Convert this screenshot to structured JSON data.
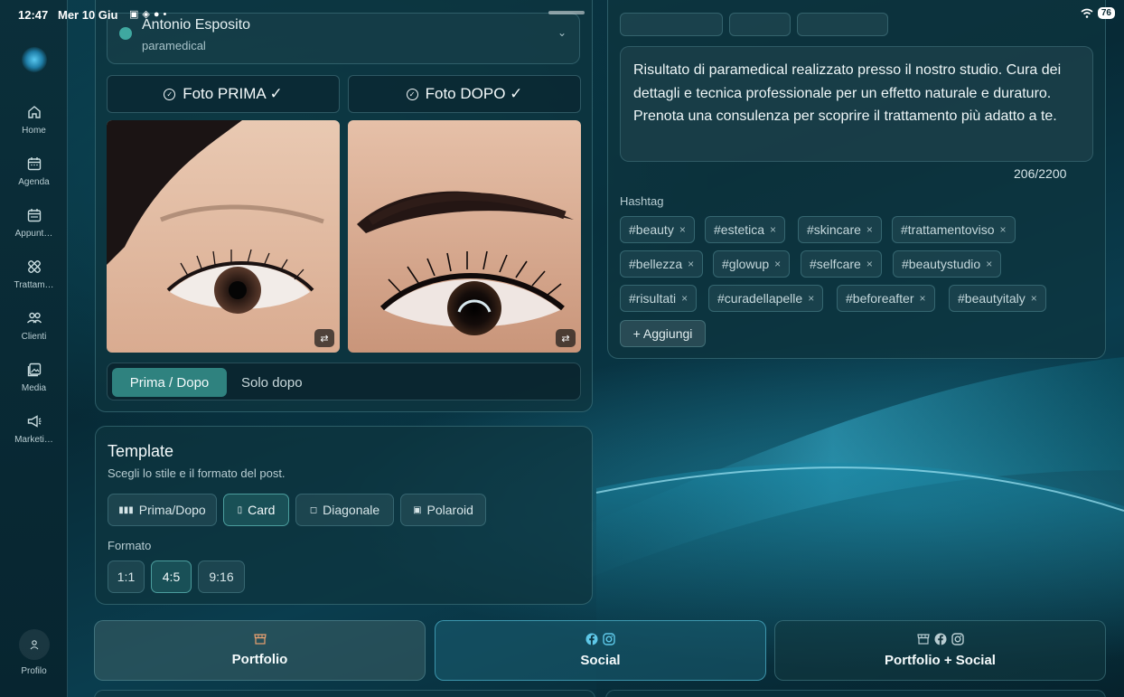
{
  "status_bar": {
    "time": "12:47",
    "date": "Mer 10 Giu",
    "battery": "76"
  },
  "sidebar": {
    "items": [
      {
        "label": "Home",
        "icon": "home-icon"
      },
      {
        "label": "Agenda",
        "icon": "calendar-icon"
      },
      {
        "label": "Appunt…",
        "icon": "appointments-icon"
      },
      {
        "label": "Trattam…",
        "icon": "treatments-icon"
      },
      {
        "label": "Clienti",
        "icon": "clients-icon"
      },
      {
        "label": "Media",
        "icon": "media-icon"
      },
      {
        "label": "Marketi…",
        "icon": "megaphone-icon"
      }
    ],
    "profile_label": "Profilo"
  },
  "client": {
    "name": "Antonio Esposito",
    "treatment": "paramedical"
  },
  "photos": {
    "before_label": "Foto PRIMA ✓",
    "after_label": "Foto DOPO ✓",
    "mode_active": "Prima / Dopo",
    "mode_other": "Solo dopo"
  },
  "template": {
    "title": "Template",
    "subtitle": "Scegli lo stile e il formato del post.",
    "styles": [
      "Prima/Dopo",
      "Card",
      "Diagonale",
      "Polaroid"
    ],
    "selected_style": "Card",
    "format_label": "Formato",
    "formats": [
      "1:1",
      "4:5",
      "9:16"
    ],
    "selected_format": "4:5"
  },
  "caption": {
    "text": "Risultato di paramedical realizzato presso il nostro studio. Cura dei dettagli e tecnica professionale per un effetto naturale e duraturo. Prenota una consulenza per scoprire il trattamento più adatto a te.",
    "counter": "206/2200",
    "hashtag_label": "Hashtag",
    "hashtags": [
      [
        "#beauty",
        "#estetica",
        "#skincare",
        "#trattamentoviso"
      ],
      [
        "#bellezza",
        "#glowup",
        "#selfcare",
        "#beautystudio"
      ],
      [
        "#risultati",
        "#curadellapelle",
        "#beforeafter",
        "#beautyitaly"
      ]
    ],
    "add_label": "+ Aggiungi"
  },
  "publish": {
    "portfolio": "Portfolio",
    "social": "Social",
    "both": "Portfolio + Social"
  },
  "colors": {
    "accent": "#2f827f",
    "social_accent": "#5ec8e8",
    "portfolio_icon": "#e8a070"
  }
}
